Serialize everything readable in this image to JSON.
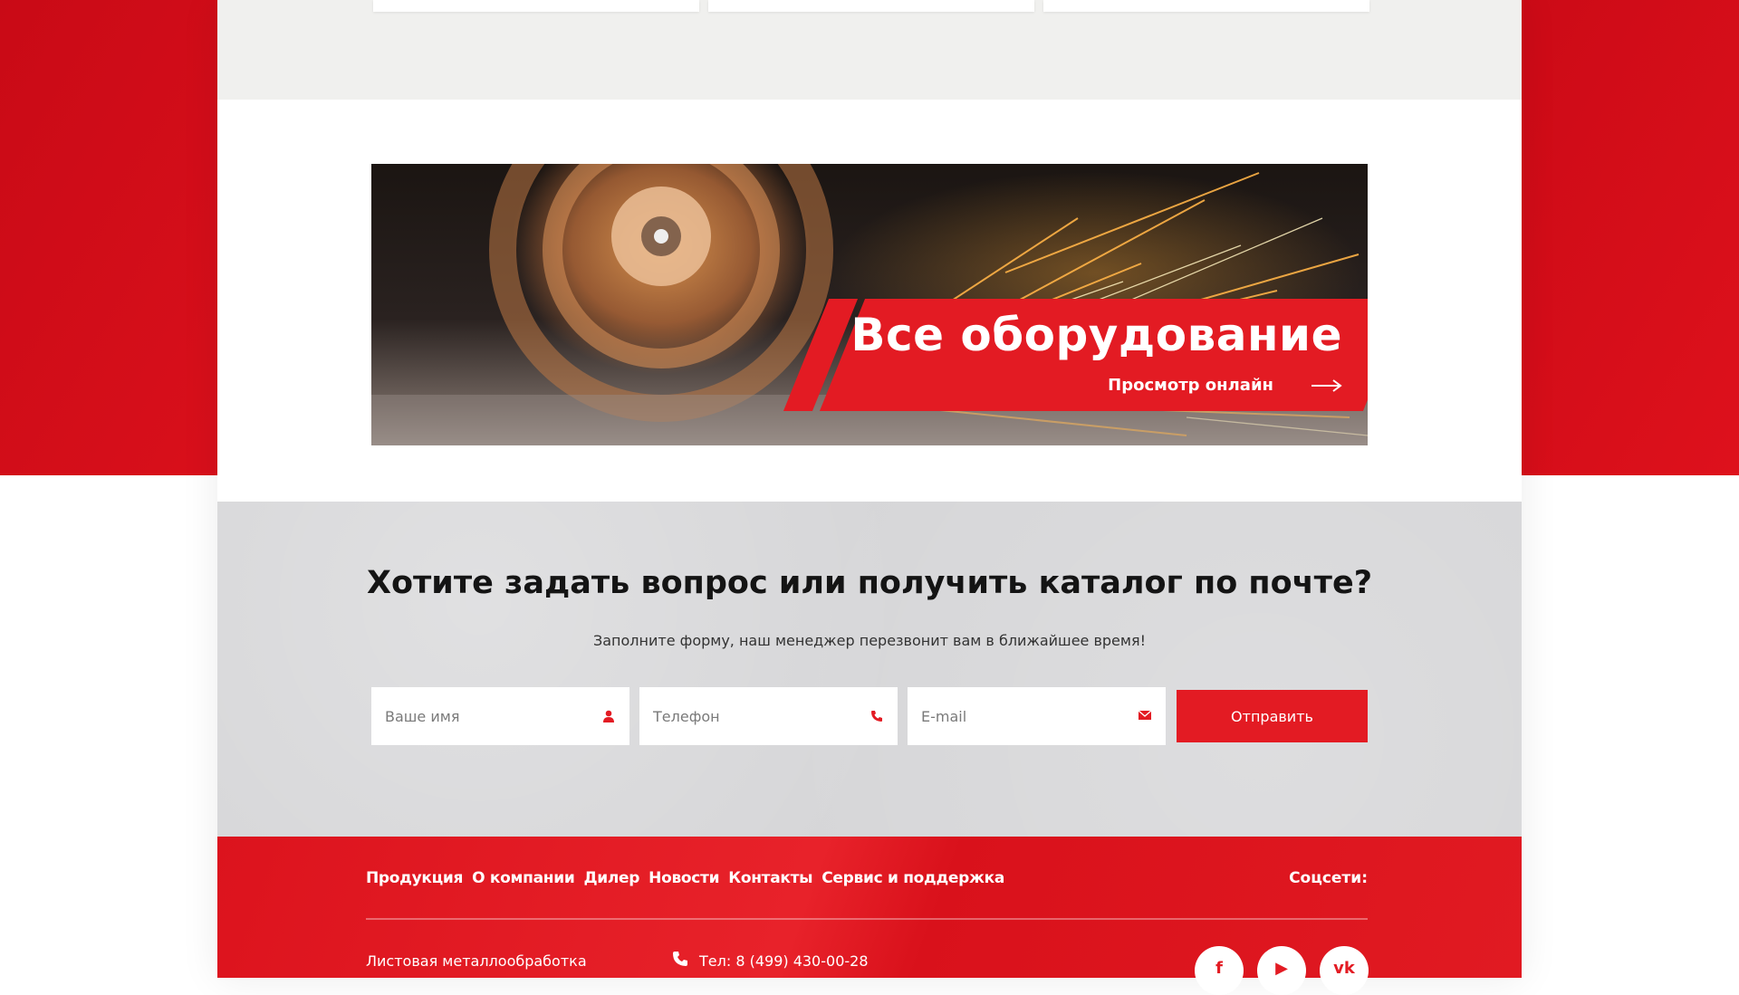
{
  "banner": {
    "title": "Все оборудование",
    "link_label": "Просмотр онлайн"
  },
  "contact": {
    "title": "Хотите задать вопрос или получить каталог по почте?",
    "subtitle": "Заполните форму, наш менеджер перезвонит вам в ближайшее время!",
    "name_placeholder": "Ваше имя",
    "phone_placeholder": "Телефон",
    "email_placeholder": "E-mail",
    "submit_label": "Отправить"
  },
  "footer": {
    "nav": [
      "Продукция",
      "О компании",
      "Дилер",
      "Новости",
      "Контакты",
      "Сервис и поддержка"
    ],
    "social_label": "Соцсети:",
    "service_text": "Листовая металлообработка",
    "phone_text": "Тел: 8 (499) 430-00-28",
    "social_icons": [
      "facebook-icon",
      "youtube-icon",
      "vk-icon"
    ]
  },
  "colors": {
    "accent": "#e31b23",
    "section_grey": "#d6d6d8",
    "top_grey": "#f0f0ee"
  }
}
